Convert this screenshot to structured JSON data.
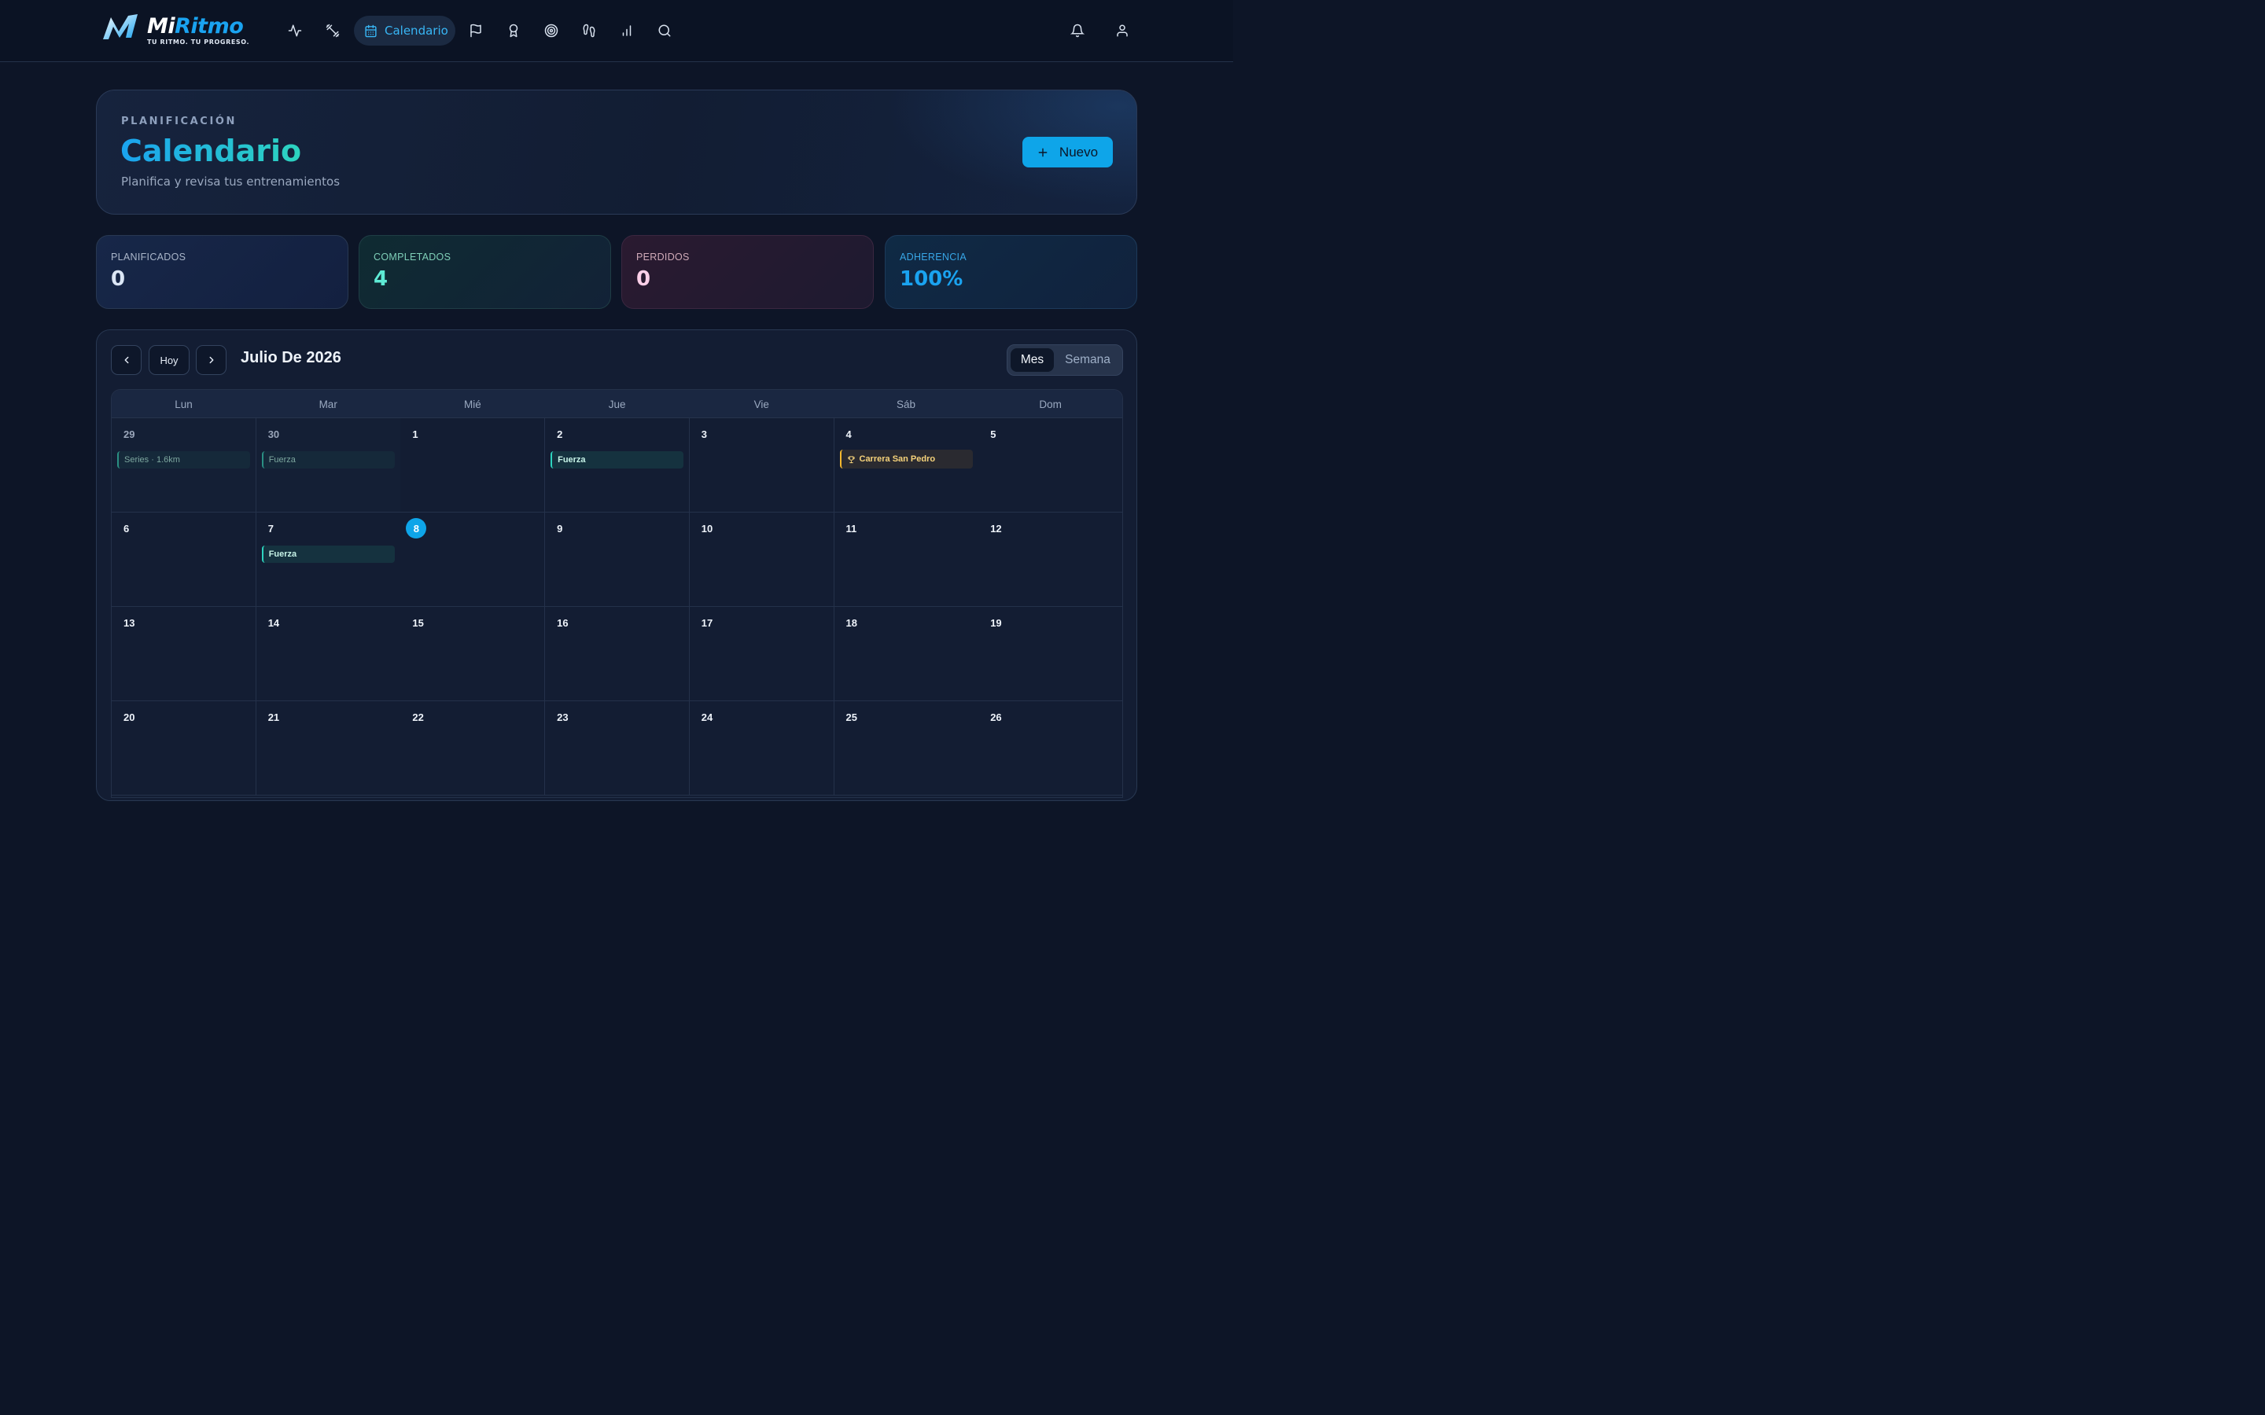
{
  "app": {
    "name_part1": "Mi",
    "name_part2": "Ritmo",
    "tagline": "TU RITMO. TU PROGRESO."
  },
  "nav": {
    "items": [
      {
        "icon": "activity-icon"
      },
      {
        "icon": "dumbbell-icon"
      },
      {
        "icon": "calendar-icon",
        "label": "Calendario",
        "active": true
      },
      {
        "icon": "flag-icon"
      },
      {
        "icon": "award-icon"
      },
      {
        "icon": "target-icon"
      },
      {
        "icon": "footprints-icon"
      },
      {
        "icon": "bar-chart-icon"
      },
      {
        "icon": "search-icon"
      }
    ],
    "active_label": "Calendario",
    "right_icons": [
      "bell-icon",
      "user-icon"
    ]
  },
  "hero": {
    "eyebrow": "PLANIFICACIÓN",
    "title": "Calendario",
    "subtitle": "Planifica y revisa tus entrenamientos",
    "new_button": "Nuevo"
  },
  "stats": [
    {
      "label": "PLANIFICADOS",
      "value": "0"
    },
    {
      "label": "COMPLETADOS",
      "value": "4"
    },
    {
      "label": "PERDIDOS",
      "value": "0"
    },
    {
      "label": "ADHERENCIA",
      "value": "100%"
    }
  ],
  "calendar": {
    "today_button": "Hoy",
    "month_title": "Julio De 2026",
    "views": {
      "month": "Mes",
      "week": "Semana",
      "selected": "Mes"
    },
    "weekdays": [
      "Lun",
      "Mar",
      "Mié",
      "Jue",
      "Vie",
      "Sáb",
      "Dom"
    ],
    "weeks": [
      [
        {
          "day": "29",
          "outside": true,
          "events": [
            {
              "label": "Series · 1.6km",
              "kind": "faded"
            }
          ]
        },
        {
          "day": "30",
          "outside": true,
          "events": [
            {
              "label": "Fuerza",
              "kind": "faded"
            }
          ]
        },
        {
          "day": "1"
        },
        {
          "day": "2",
          "events": [
            {
              "label": "Fuerza",
              "kind": "workout"
            }
          ]
        },
        {
          "day": "3"
        },
        {
          "day": "4",
          "events": [
            {
              "label": "Carrera San Pedro",
              "kind": "race"
            }
          ]
        },
        {
          "day": "5"
        }
      ],
      [
        {
          "day": "6"
        },
        {
          "day": "7",
          "events": [
            {
              "label": "Fuerza",
              "kind": "workout"
            }
          ]
        },
        {
          "day": "8",
          "today": true
        },
        {
          "day": "9"
        },
        {
          "day": "10"
        },
        {
          "day": "11"
        },
        {
          "day": "12"
        }
      ],
      [
        {
          "day": "13"
        },
        {
          "day": "14"
        },
        {
          "day": "15"
        },
        {
          "day": "16"
        },
        {
          "day": "17"
        },
        {
          "day": "18"
        },
        {
          "day": "19"
        }
      ],
      [
        {
          "day": "20"
        },
        {
          "day": "21"
        },
        {
          "day": "22"
        },
        {
          "day": "23"
        },
        {
          "day": "24"
        },
        {
          "day": "25"
        },
        {
          "day": "26"
        }
      ]
    ]
  },
  "colors": {
    "accent": "#0ea5e9",
    "workout_border": "#2dd4bf",
    "race_border": "#f5b82e"
  }
}
